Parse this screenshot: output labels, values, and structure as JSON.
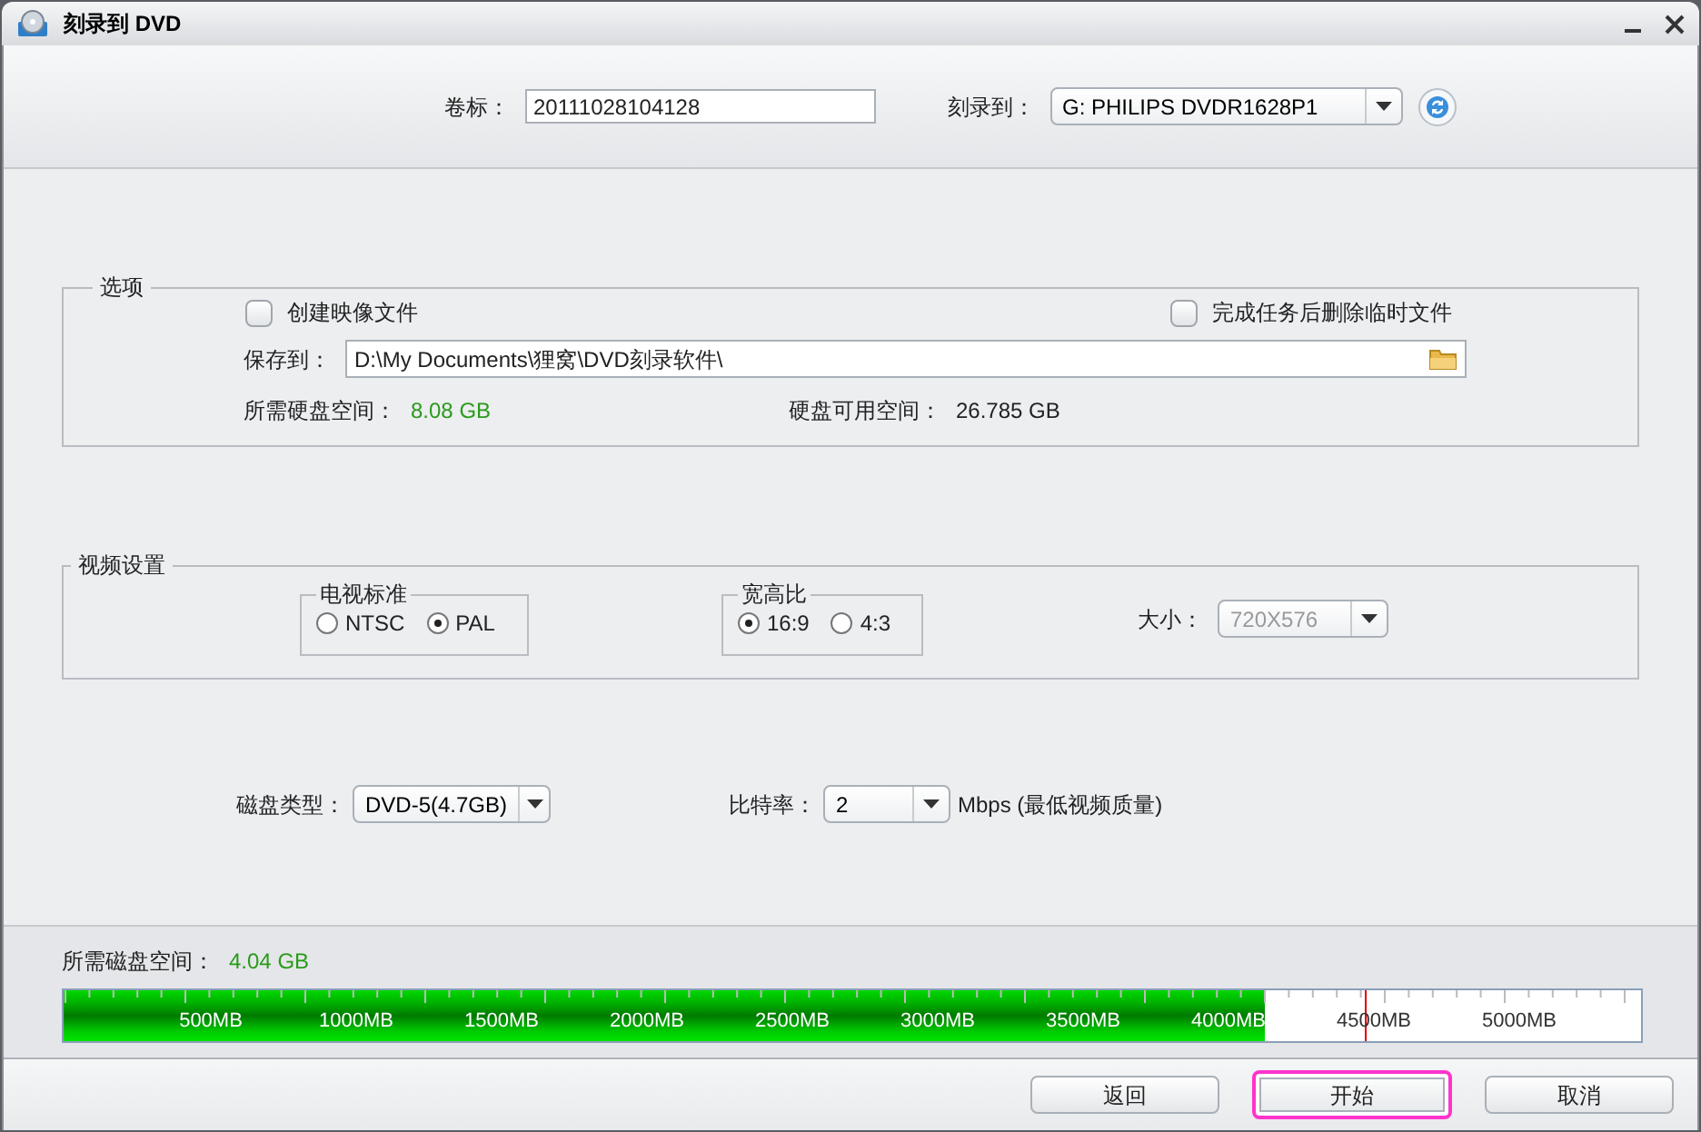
{
  "window": {
    "title": "刻录到 DVD"
  },
  "header": {
    "volume_label": "卷标：",
    "volume_value": "20111028104128",
    "burn_to_label": "刻录到：",
    "burn_to_value": "G: PHILIPS  DVDR1628P1"
  },
  "options": {
    "title": "选项",
    "checkboxes": [
      {
        "label": "创建映像文件",
        "checked": false
      },
      {
        "label": "完成任务后删除临时文件",
        "checked": false
      }
    ],
    "save_label": "保存到：",
    "save_path": "D:\\My Documents\\狸窝\\DVD刻录软件\\",
    "required_label": "所需硬盘空间：",
    "required_value": "8.08 GB",
    "free_label": "硬盘可用空间：",
    "free_value": "26.785 GB"
  },
  "video": {
    "title": "视频设置",
    "groups": [
      {
        "title": "电视标准",
        "radios": [
          {
            "label": "NTSC",
            "selected": false
          },
          {
            "label": "PAL",
            "selected": true
          }
        ]
      },
      {
        "title": "宽高比",
        "radios": [
          {
            "label": "16:9",
            "selected": true
          },
          {
            "label": "4:3",
            "selected": false
          }
        ]
      }
    ],
    "size_label": "大小：",
    "size_value": "720X576",
    "size_disabled": true
  },
  "disc": {
    "type_label": "磁盘类型：",
    "type_value": "DVD-5(4.7GB)",
    "bitrate_label": "比特率：",
    "bitrate_value": "2",
    "bitrate_unit": "Mbps (最低视频质量)"
  },
  "capacity": {
    "label": "所需磁盘空间：",
    "value": "4.04 GB",
    "level": 0.762,
    "ticks": [
      "500MB",
      "1000MB",
      "1500MB",
      "2000MB",
      "2500MB",
      "3000MB",
      "3500MB",
      "4000MB",
      "4500MB",
      "5000MB"
    ]
  },
  "buttons": [
    {
      "label": "返回",
      "focused": false
    },
    {
      "label": "开始",
      "focused": true
    },
    {
      "label": "取消",
      "focused": false
    }
  ]
}
